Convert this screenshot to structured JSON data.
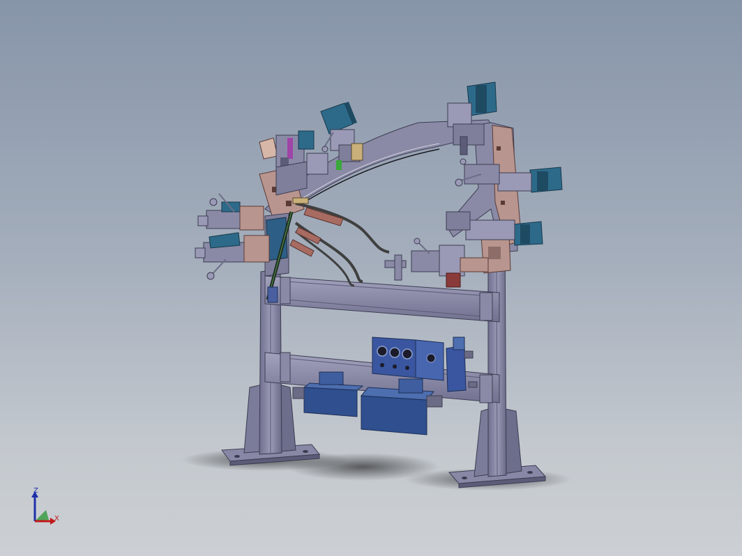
{
  "viewport": {
    "background_top": "#8795a9",
    "background_bottom": "#ccd0d4"
  },
  "model": {
    "frame_color": "#7f7f9c",
    "frame_dark": "#55556e",
    "arch_color": "#8a8aa6",
    "bracket_color": "#b8958e",
    "cylinder_color": "#2d5f86",
    "control_panel_color": "#3a56a0",
    "motor_color": "#2f4f8e",
    "cable_color": "#3f3f3f",
    "sleeve_color": "#a86b62"
  },
  "triad": {
    "z_label": "Z",
    "x_label": "X",
    "z_color": "#1e2fa8",
    "x_color": "#c01818",
    "y_color": "#2f9a3a"
  }
}
